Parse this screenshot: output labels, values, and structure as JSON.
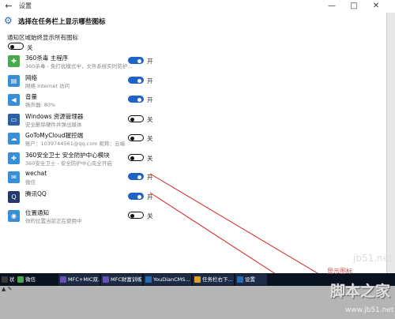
{
  "window": {
    "title": "设置",
    "back_glyph": "←",
    "min_glyph": "—",
    "max_glyph": "□",
    "close_glyph": "✕"
  },
  "header": {
    "title": "选择在任务栏上显示哪些图标"
  },
  "always_show": {
    "label": "通知区域始终显示所有图标",
    "state": "关",
    "on": false
  },
  "apps": [
    {
      "name": "360杀毒 主程序",
      "desc": "360杀毒 - 免打扰模式中，文件系统实时防护...",
      "state": "开",
      "on": true,
      "icon": "shield-360-icon",
      "glyph": "✚"
    },
    {
      "name": "网络",
      "desc": "网络 Internet 访问",
      "state": "开",
      "on": true,
      "icon": "network-icon",
      "glyph": "▤"
    },
    {
      "name": "音量",
      "desc": "扬声器: 80%",
      "state": "开",
      "on": true,
      "icon": "volume-icon",
      "glyph": "◀"
    },
    {
      "name": "Windows 资源管理器",
      "desc": "安全删除硬件并弹出媒体",
      "state": "关",
      "on": false,
      "icon": "explorer-icon",
      "glyph": "▭"
    },
    {
      "name": "GoToMyCloud猩控端",
      "desc": "账户：1039744561@qq.com 昵称：云端",
      "state": "关",
      "on": false,
      "icon": "cloud-icon",
      "glyph": "☁"
    },
    {
      "name": "360安全卫士 安全防护中心模块",
      "desc": "360安全卫士 - 安全防护中心完全开启",
      "state": "关",
      "on": false,
      "icon": "shield-guard-icon",
      "glyph": "✚"
    },
    {
      "name": "wechat",
      "desc": "微信",
      "state": "开",
      "on": true,
      "icon": "wechat-icon",
      "glyph": "✉"
    },
    {
      "name": "腾讯QQ",
      "desc": "",
      "state": "开",
      "on": true,
      "icon": "qq-icon",
      "glyph": "Q"
    },
    {
      "name": "位置通知",
      "desc": "你的位置当前正在使用中",
      "state": "关",
      "on": false,
      "icon": "location-icon",
      "glyph": "◉"
    }
  ],
  "taskbar": {
    "items": [
      {
        "label": "状午...",
        "color": "#3a3a3a"
      },
      {
        "label": "微信",
        "color": "#4aa84f"
      },
      {
        "label": "MFC+MIC双...",
        "color": "#6a4fb0"
      },
      {
        "label": "MFC财富训练营",
        "color": "#6a4fb0"
      },
      {
        "label": "YouDianCMS...",
        "color": "#2b6cb0"
      },
      {
        "label": "任务栏右下...",
        "color": "#e0a020"
      },
      {
        "label": "设置",
        "color": "#2b6cb0"
      }
    ]
  },
  "under_bar": {
    "left_text": "▲ ✎"
  },
  "annotation": {
    "text": "显示图标"
  },
  "watermark": {
    "top": "jb51.net",
    "main": "脚本之家",
    "sub": "www.jb51.net"
  },
  "colors": {
    "toggle_on": "#1f63c6",
    "arrow": "#d02020",
    "taskbar": "#0a1220"
  }
}
